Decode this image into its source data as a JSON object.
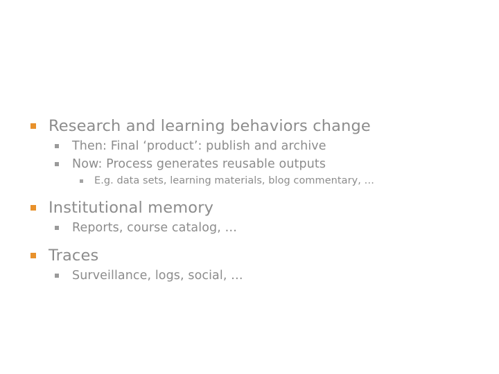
{
  "slide": {
    "background_color": "#ffffff",
    "text_color": "#8c8c8c",
    "accent_color": "#E8912B",
    "sub_bullet_color": "#9a9a9a",
    "outline": [
      {
        "level": 1,
        "bullet": "square-bullet-orange",
        "text": "Research and learning behaviors change"
      },
      {
        "level": 2,
        "bullet": "square-bullet-gray",
        "text": "Then: Final ‘product’: publish and archive"
      },
      {
        "level": 2,
        "bullet": "square-bullet-gray",
        "text": "Now: Process generates reusable outputs"
      },
      {
        "level": 3,
        "bullet": "square-bullet-gray-small",
        "text": "E.g. data sets, learning materials, blog commentary, …"
      },
      {
        "level": 1,
        "bullet": "square-bullet-orange",
        "text": "Institutional memory"
      },
      {
        "level": 2,
        "bullet": "square-bullet-gray",
        "text": "Reports, course catalog, …"
      },
      {
        "level": 1,
        "bullet": "square-bullet-orange",
        "text": "Traces"
      },
      {
        "level": 2,
        "bullet": "square-bullet-gray",
        "text": "Surveillance, logs, social, …"
      }
    ]
  }
}
